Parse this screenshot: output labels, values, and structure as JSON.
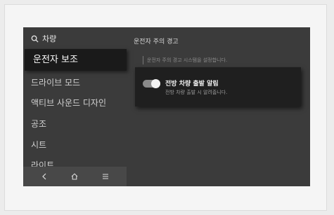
{
  "sidebar": {
    "search_label": "차량",
    "items": [
      {
        "label": "운전자 보조",
        "active": true
      },
      {
        "label": "드라이브 모드"
      },
      {
        "label": "액티브 사운드 디자인"
      },
      {
        "label": "공조"
      },
      {
        "label": "시트"
      },
      {
        "label": "라이트"
      }
    ]
  },
  "navbar": {
    "icons": [
      "back-icon",
      "home-icon",
      "menu-icon"
    ]
  },
  "content": {
    "title": "운전자 주의 경고",
    "description": "운전자 주의 경고 시스템을 설정합니다."
  },
  "popup": {
    "title": "전방 차량 출발 알림",
    "description": "전방 차량 출발 시 알려줍니다.",
    "toggle_on": true
  },
  "colors": {
    "screen_bg": "#3b3b3b",
    "active_item_bg": "#1a1a1a",
    "popup_bg": "#1f1f1f"
  }
}
